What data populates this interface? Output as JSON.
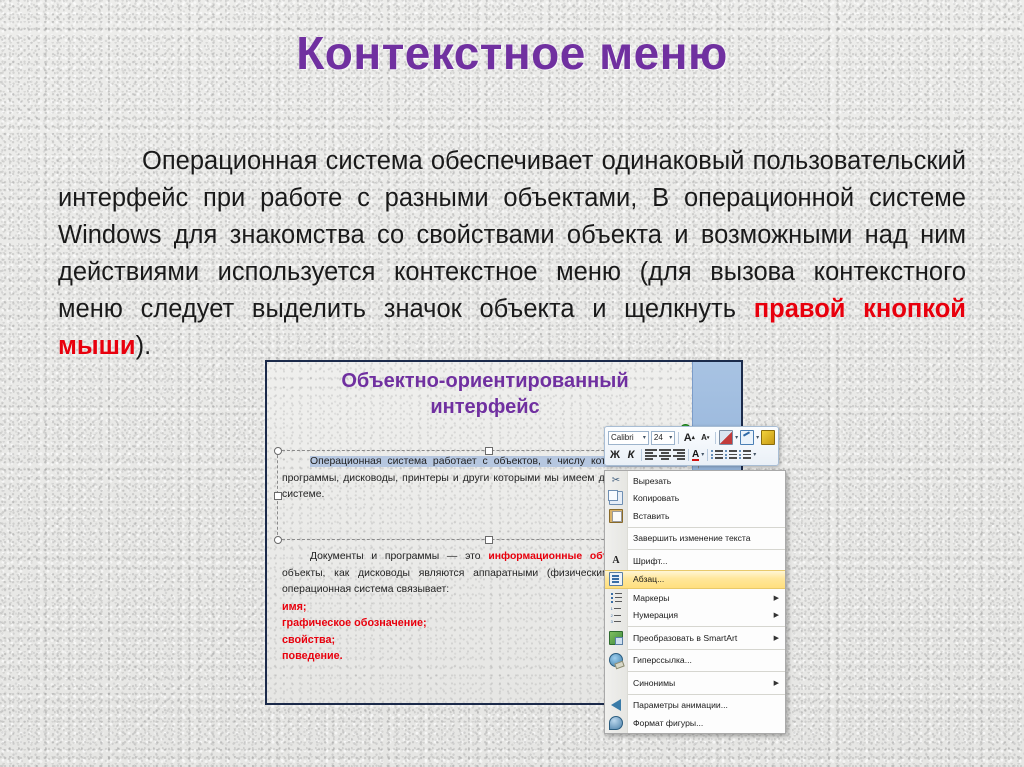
{
  "slide": {
    "title": "Контекстное меню",
    "title_color": "#7030A0",
    "body": {
      "p1_part1": "Операционная система обеспечивает одинаковый пользовательский интерфейс при работе с разными объектами, В операционной системе Windows для знакомства со свойствами объекта и возможными над ним действиями используется контекстное меню  (для вызова контекстного меню следует выделить значок объекта и щелкнуть ",
      "p1_highlight": "правой кнопкой мыши",
      "p1_part2": ").",
      "highlight_color": "#E8000D"
    }
  },
  "screenshot": {
    "inner_slide": {
      "title_line1": "Объектно-ориентированный",
      "title_line2": "интерфейс",
      "title_color": "#7030A0",
      "textblock1": {
        "selected_text": "Операционная система работает с объектов, к числу которых относятся:",
        "rest": " программы, дисководы, принтеры и други которыми мы имеем дело, работая в с системе."
      },
      "textblock2": {
        "lead": "Документы и программы — это ",
        "red1": "информационные объекты",
        "after_red1": ". А такие объекты, как дисководы являются аппаратными (физическими) с объектом операционная система связывает:",
        "list": [
          "имя;",
          "графическое обозначение;",
          "свойства;",
          "поведение."
        ]
      }
    },
    "minibar": {
      "font_name": "Calibri",
      "font_size": "24",
      "grow_font": "A",
      "shrink_font": "A",
      "bold": "Ж",
      "italic": "К",
      "font_color": "A",
      "icons": [
        "grow-font-icon",
        "shrink-font-icon",
        "text-highlight-icon",
        "format-painter-pen-icon",
        "clear-formatting-brush-icon",
        "bold-icon",
        "italic-icon",
        "align-left-icon",
        "align-center-icon",
        "align-right-icon",
        "font-color-icon",
        "decrease-indent-icon",
        "increase-indent-icon",
        "bullets-icon"
      ]
    },
    "context_menu": {
      "items": [
        {
          "label": "Вырезать",
          "icon": "scissors-icon",
          "submenu": false,
          "selected": false,
          "sep_after": false
        },
        {
          "label": "Копировать",
          "icon": "copy-icon",
          "submenu": false,
          "selected": false,
          "sep_after": false
        },
        {
          "label": "Вставить",
          "icon": "paste-icon",
          "submenu": false,
          "selected": false,
          "sep_after": true
        },
        {
          "label": "Завершить изменение текста",
          "icon": "none",
          "submenu": false,
          "selected": false,
          "sep_after": true
        },
        {
          "label": "Шрифт...",
          "icon": "font-A-icon",
          "submenu": false,
          "selected": false,
          "sep_after": false
        },
        {
          "label": "Абзац...",
          "icon": "paragraph-icon",
          "submenu": false,
          "selected": true,
          "sep_after": false
        },
        {
          "label": "Маркеры",
          "icon": "bullets-icon",
          "submenu": true,
          "selected": false,
          "sep_after": false
        },
        {
          "label": "Нумерация",
          "icon": "numbering-icon",
          "submenu": true,
          "selected": false,
          "sep_after": true
        },
        {
          "label": "Преобразовать в SmartArt",
          "icon": "smartart-icon",
          "submenu": true,
          "selected": false,
          "sep_after": true
        },
        {
          "label": "Гиперссылка...",
          "icon": "hyperlink-icon",
          "submenu": false,
          "selected": false,
          "sep_after": true
        },
        {
          "label": "Синонимы",
          "icon": "none",
          "submenu": true,
          "selected": false,
          "sep_after": true
        },
        {
          "label": "Параметры анимации...",
          "icon": "animation-icon",
          "submenu": false,
          "selected": false,
          "sep_after": false
        },
        {
          "label": "Формат фигуры...",
          "icon": "shape-format-icon",
          "submenu": false,
          "selected": false,
          "sep_after": false
        }
      ],
      "highlight_color": "#FFDF7E"
    },
    "accent_blue": "#90B0D8"
  }
}
